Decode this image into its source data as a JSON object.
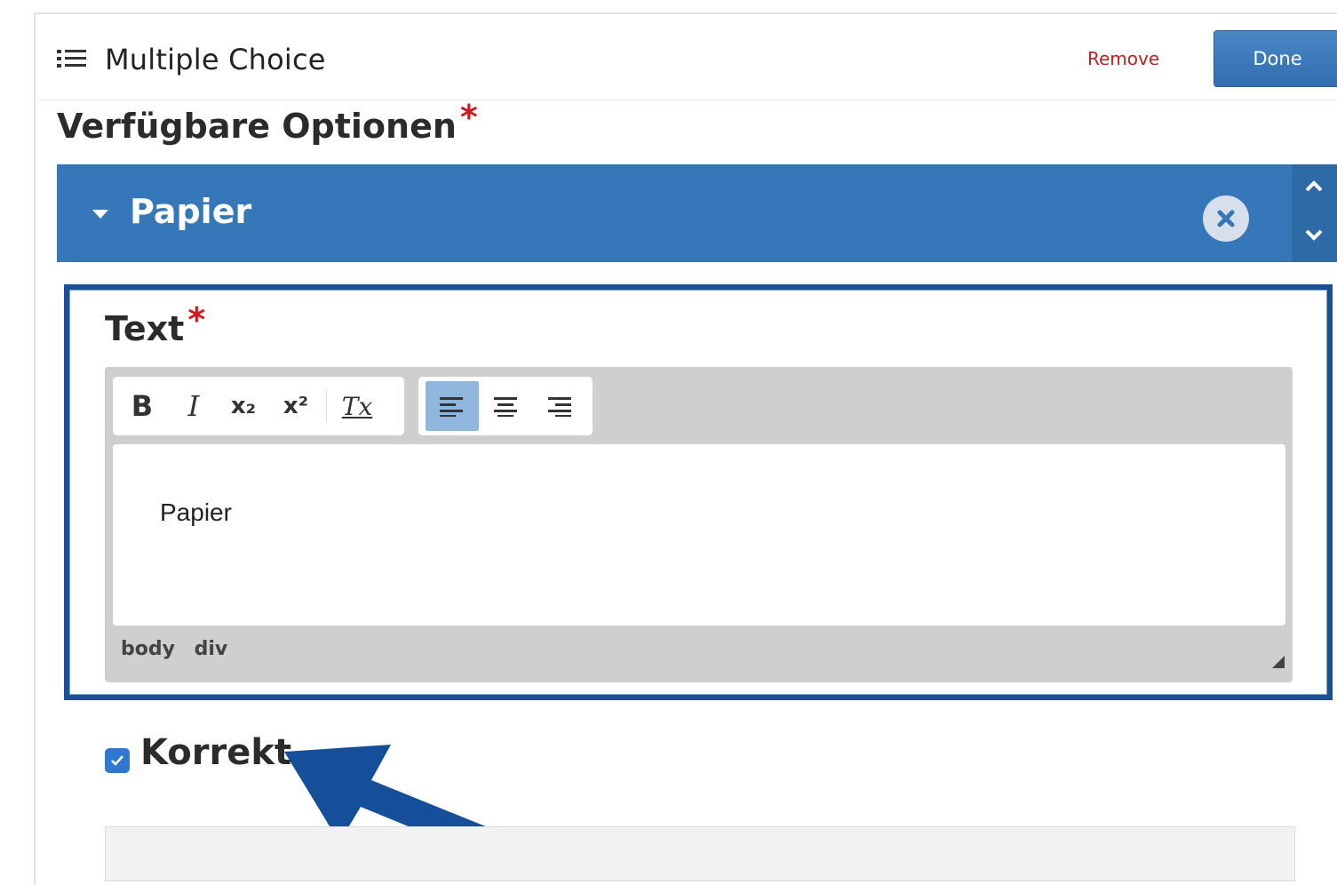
{
  "header": {
    "title": "Multiple Choice",
    "icon": "list-icon",
    "remove_label": "Remove",
    "done_label": "Done"
  },
  "section": {
    "title": "Verfügbare Optionen",
    "required_mark": "*"
  },
  "option": {
    "title": "Papier",
    "close_icon": "close-circle-icon",
    "reorder_icons": [
      "chevron-up-icon",
      "chevron-down-icon"
    ]
  },
  "text_field": {
    "label": "Text",
    "required_mark": "*",
    "toolbar": {
      "bold": "B",
      "italic": "I",
      "subscript": "x₂",
      "superscript": "x²",
      "clear_format": "Tx",
      "align_left": "align-left-icon",
      "align_center": "align-center-icon",
      "align_right": "align-right-icon",
      "active": "align-left"
    },
    "content": "Papier",
    "status_path": "body div"
  },
  "correct_checkbox": {
    "label": "Korrekt",
    "checked": true
  },
  "colors": {
    "accent": "#3577b9",
    "focus_frame": "#1d4f94",
    "required": "#d0191e",
    "remove": "#b32424"
  }
}
